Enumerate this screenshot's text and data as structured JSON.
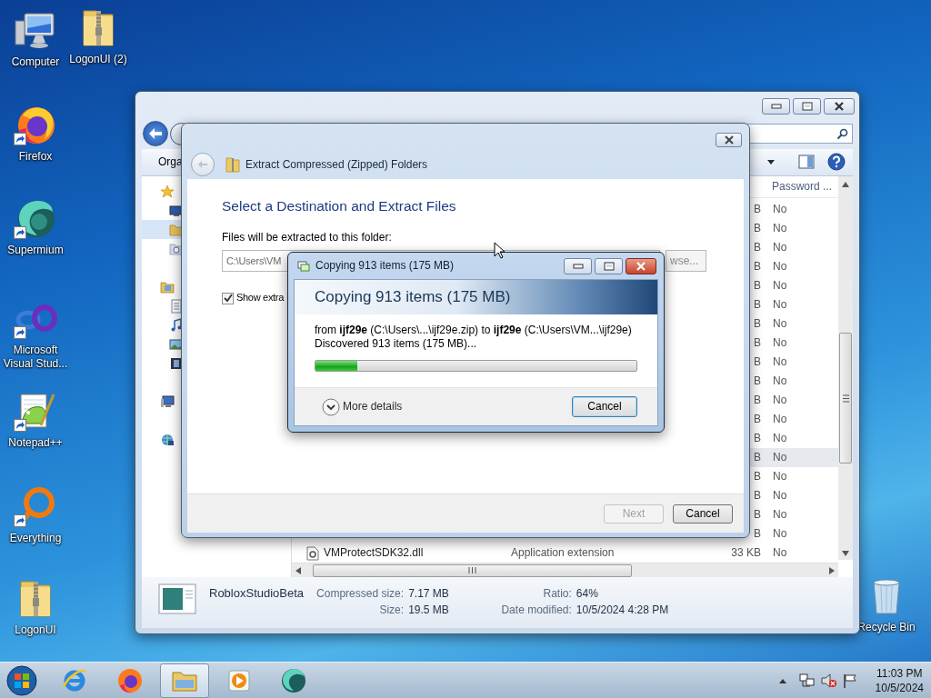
{
  "desktop_icons": [
    {
      "label": "Computer",
      "kind": "computer",
      "shortcut": false
    },
    {
      "label": "LogonUI (2)",
      "kind": "zip-folder",
      "shortcut": false
    },
    {
      "label": "Firefox",
      "kind": "firefox",
      "shortcut": true
    },
    {
      "label": "Supermium",
      "kind": "supermium",
      "shortcut": true
    },
    {
      "label": "Microsoft Visual Stud...",
      "kind": "visual-studio",
      "shortcut": true
    },
    {
      "label": "Notepad++",
      "kind": "notepad",
      "shortcut": true
    },
    {
      "label": "Everything",
      "kind": "everything",
      "shortcut": true
    },
    {
      "label": "LogonUI",
      "kind": "zip-folder",
      "shortcut": false
    },
    {
      "label": "Recycle Bin",
      "kind": "recycle-bin",
      "shortcut": false
    }
  ],
  "explorer": {
    "toolbar": {
      "organize": "Orga"
    },
    "nav_pane": [
      {
        "kind": "favorites",
        "selected": false
      },
      {
        "kind": "desktop",
        "selected": false
      },
      {
        "kind": "folder",
        "selected": true
      },
      {
        "kind": "recent",
        "selected": false
      },
      {
        "kind": "libraries",
        "selected": false
      },
      {
        "kind": "documents",
        "selected": false
      },
      {
        "kind": "music",
        "selected": false
      },
      {
        "kind": "pictures",
        "selected": false
      },
      {
        "kind": "videos",
        "selected": false
      },
      {
        "kind": "computer",
        "selected": false
      },
      {
        "kind": "network",
        "selected": false
      }
    ],
    "columns": [
      {
        "label": "Password ..."
      }
    ],
    "rows": [
      {
        "size": "B",
        "password": "No",
        "selected": false
      },
      {
        "size": "B",
        "password": "No",
        "selected": false
      },
      {
        "size": "B",
        "password": "No",
        "selected": false
      },
      {
        "size": "B",
        "password": "No",
        "selected": false
      },
      {
        "size": "B",
        "password": "No",
        "selected": false
      },
      {
        "size": "B",
        "password": "No",
        "selected": false
      },
      {
        "size": "B",
        "password": "No",
        "selected": false
      },
      {
        "size": "B",
        "password": "No",
        "selected": false
      },
      {
        "size": "B",
        "password": "No",
        "selected": false
      },
      {
        "size": "B",
        "password": "No",
        "selected": false
      },
      {
        "size": "B",
        "password": "No",
        "selected": false
      },
      {
        "size": "B",
        "password": "No",
        "selected": false
      },
      {
        "size": "B",
        "password": "No",
        "selected": false
      },
      {
        "size": "B",
        "password": "No",
        "selected": true
      },
      {
        "size": "B",
        "password": "No",
        "selected": false
      },
      {
        "size": "B",
        "password": "No",
        "selected": false
      },
      {
        "size": "B",
        "password": "No",
        "selected": false
      },
      {
        "size": "B",
        "password": "No",
        "selected": false
      },
      {
        "name": "VMProtectSDK32.dll",
        "type": "Application extension",
        "size": "33 KB",
        "password": "No",
        "selected": false
      }
    ],
    "details": {
      "name": "RobloxStudioBeta",
      "properties": [
        {
          "label": "Compressed size:",
          "value": "7.17 MB"
        },
        {
          "label": "Ratio:",
          "value": "64%"
        },
        {
          "label": "Size:",
          "value": "19.5 MB"
        },
        {
          "label": "Date modified:",
          "value": "10/5/2024 4:28 PM"
        }
      ]
    }
  },
  "extract_dialog": {
    "title": "Extract Compressed (Zipped) Folders",
    "heading": "Select a Destination and Extract Files",
    "folder_label": "Files will be extracted to this folder:",
    "folder_value": "C:\\Users\\VM",
    "browse_button": "wse...",
    "show_files": {
      "label": "Show extra",
      "checked": true
    },
    "buttons": [
      {
        "label": "Next",
        "disabled": true
      },
      {
        "label": "Cancel",
        "disabled": false
      }
    ]
  },
  "copy_dialog": {
    "title": "Copying 913 items (175 MB)",
    "heading": "Copying 913 items (175 MB)",
    "from_line": "from **ijf29e** (C:\\Users\\...\\ijf29e.zip) to **ijf29e** (C:\\Users\\VM...\\ijf29e)",
    "status": "Discovered 913 items (175 MB)...",
    "level": 0.13,
    "more_details": "More details",
    "cancel": "Cancel"
  },
  "taskbar": {
    "apps": [
      {
        "kind": "ie",
        "active": false
      },
      {
        "kind": "firefox",
        "active": false
      },
      {
        "kind": "explorer",
        "active": true
      },
      {
        "kind": "media-player",
        "active": false
      },
      {
        "kind": "supermium",
        "active": false
      }
    ],
    "time": "11:03 PM",
    "date": "10/5/2024"
  }
}
